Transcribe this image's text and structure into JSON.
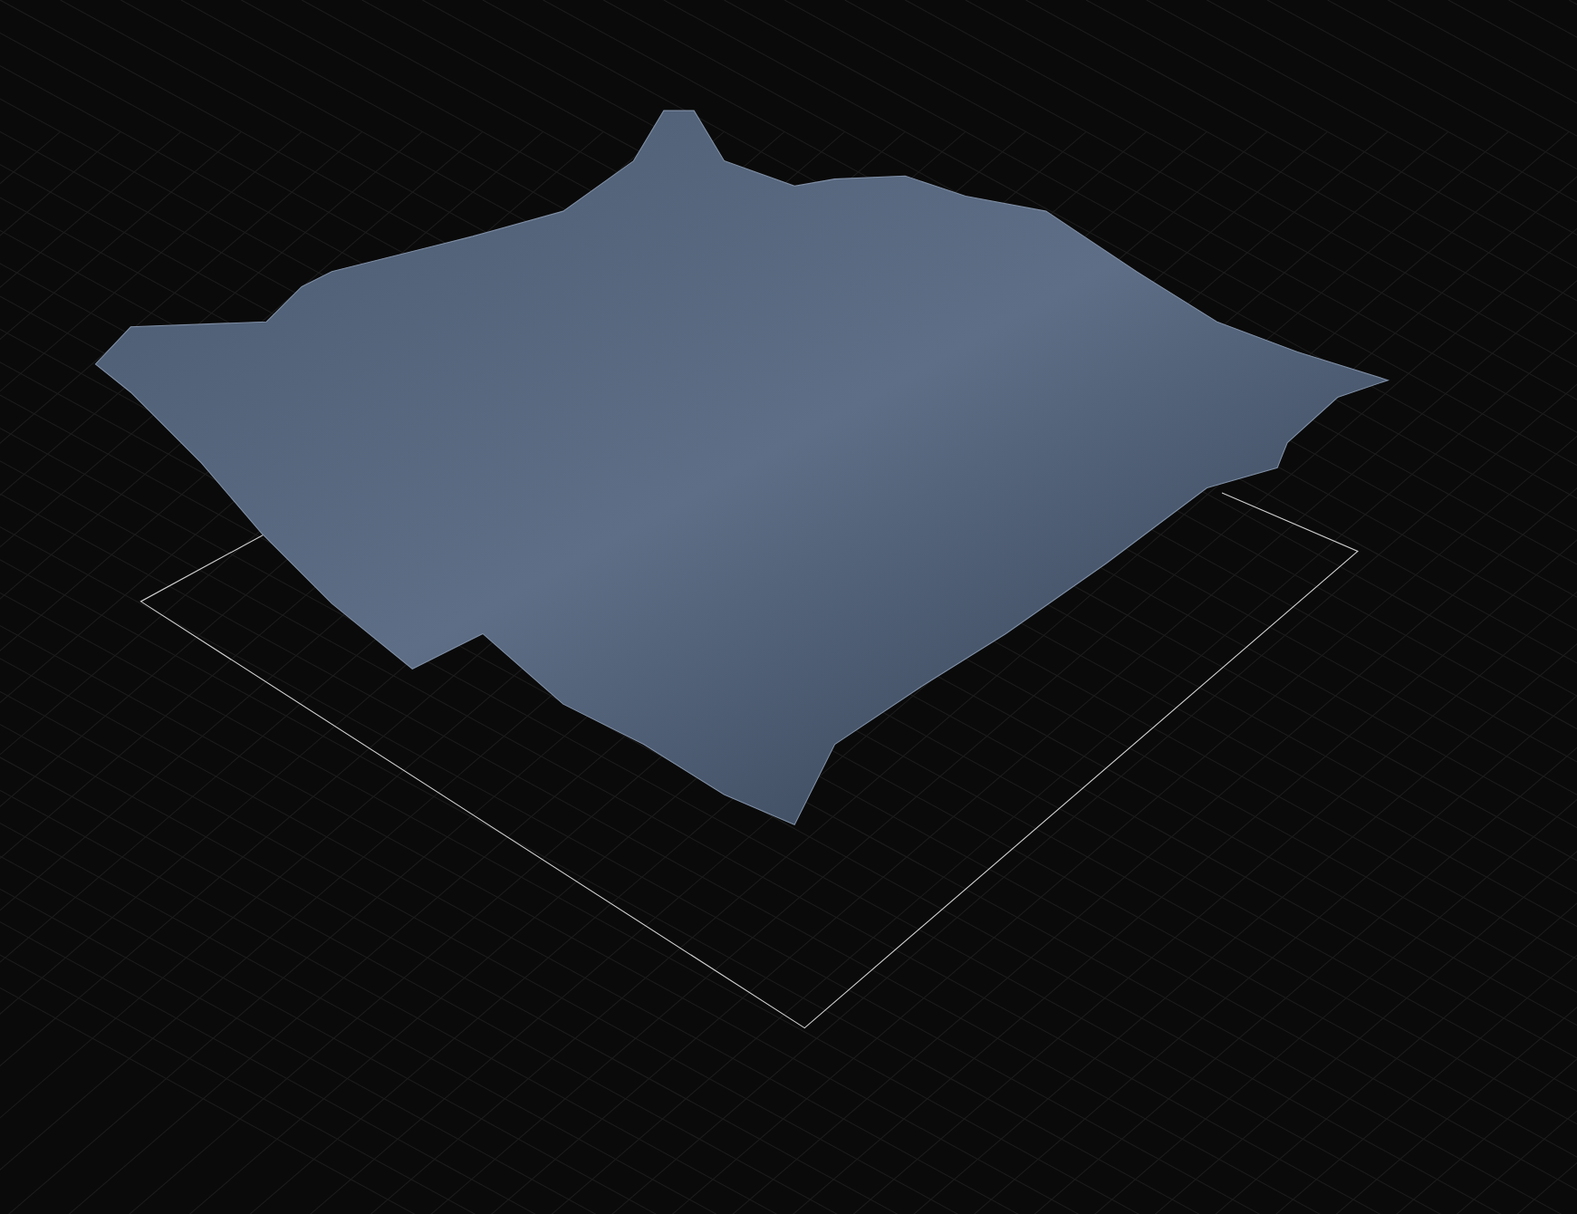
{
  "viewport": {
    "show_grid": true,
    "show_bounds": true
  }
}
